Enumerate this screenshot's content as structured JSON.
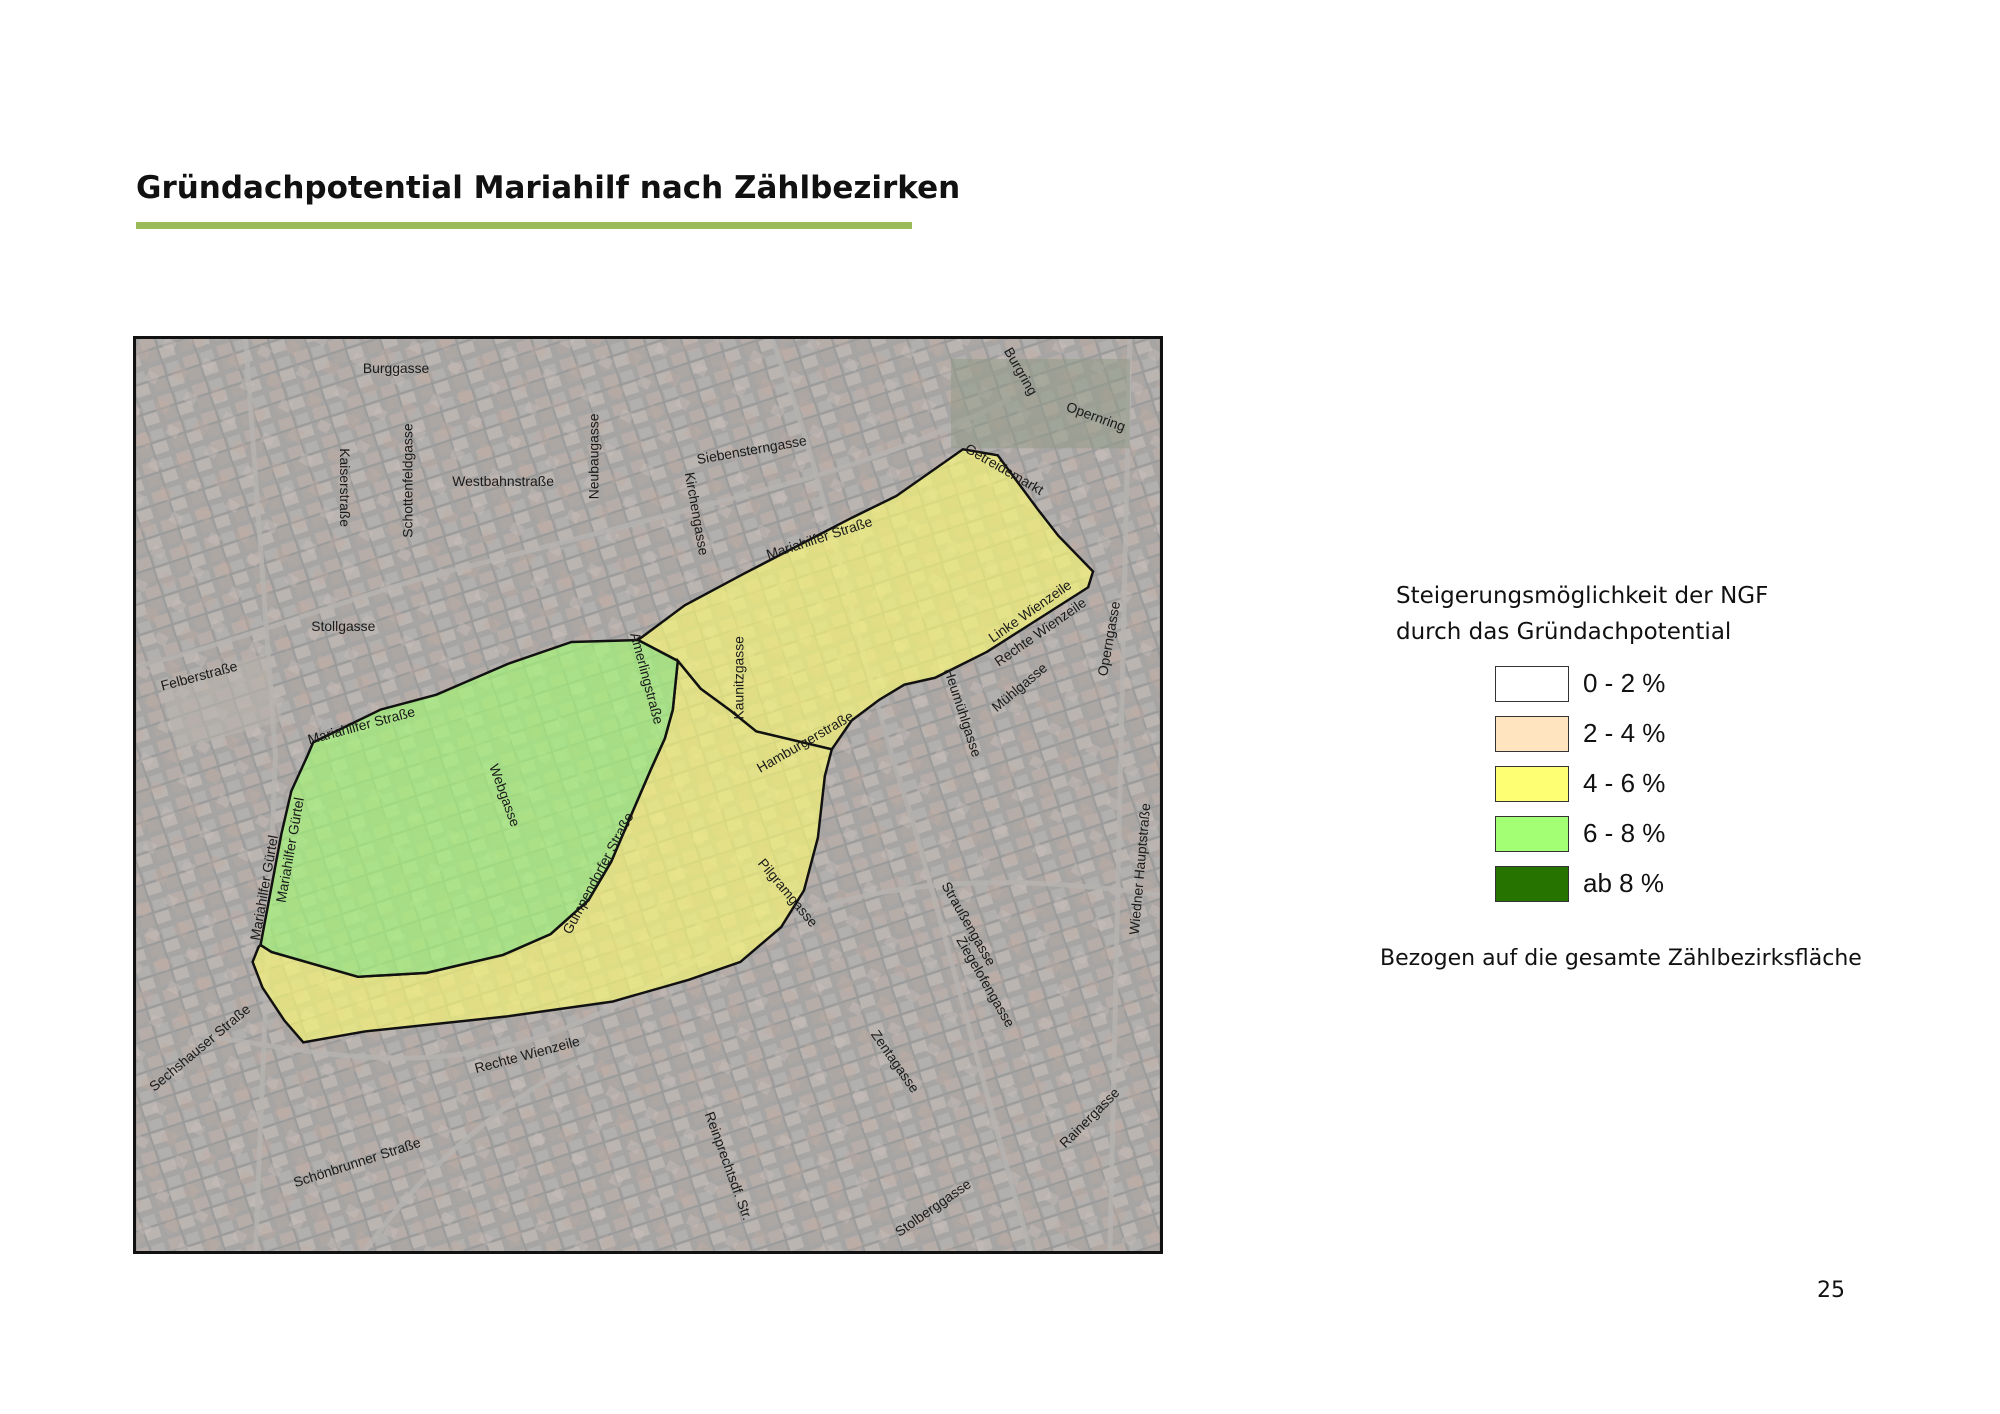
{
  "title": "Gründachpotential Mariahilf nach Zählbezirken",
  "colors": {
    "accent_rule": "#9bbb59",
    "class_0_2": "#ffffff",
    "class_2_4": "#ffe4bf",
    "class_4_6": "#ffff73",
    "class_6_8": "#a3ff73",
    "class_ab_8": "#267300"
  },
  "map": {
    "streets": [
      "Burggasse",
      "Kaiserstraße",
      "Schottenfeldgasse",
      "Westbahnstraße",
      "Neubaugasse",
      "Siebensterngasse",
      "Kirchengasse",
      "Burgring",
      "Opernring",
      "Getreidemarkt",
      "Mariahilfer Straße",
      "Stollgasse",
      "Felberstraße",
      "Amerlingstraße",
      "Kaunitzgasse",
      "Linke Wienzeile",
      "Rechte Wienzeile",
      "Mühlgasse",
      "Operngasse",
      "Mariahilfer Straße",
      "Webgasse",
      "Gumpendorfer Straße",
      "Hamburgerstraße",
      "Heumühlgasse",
      "Mariahilfer Gürtel",
      "Mariahilfer Gürtel",
      "Pilgramgasse",
      "Straußengasse",
      "Wiedner Hauptstraße",
      "Ziegelofengasse",
      "Sechshauser Straße",
      "Rechte Wienzeile",
      "Zentagasse",
      "Schönbrunner Straße",
      "Reinprechtsdf. Str.",
      "Stolberggasse",
      "Rainergasse"
    ],
    "districts": [
      {
        "name": "6-8 %",
        "class": "6 - 8 %"
      },
      {
        "name": "4-6 % east",
        "class": "4 - 6 %"
      },
      {
        "name": "4-6 % south",
        "class": "4 - 6 %"
      }
    ]
  },
  "legend": {
    "title_line1": "Steigerungsmöglichkeit der NGF",
    "title_line2": "durch das Gründachpotential",
    "items": [
      {
        "label": "0 - 2 %",
        "color": "#ffffff"
      },
      {
        "label": "2 - 4 %",
        "color": "#ffe4bf"
      },
      {
        "label": "4 - 6 %",
        "color": "#ffff73"
      },
      {
        "label": "6 - 8 %",
        "color": "#a3ff73"
      },
      {
        "label": "ab 8 %",
        "color": "#267300"
      }
    ],
    "note": "Bezogen auf die gesamte Zählbezirksfläche"
  },
  "page_number": "25"
}
